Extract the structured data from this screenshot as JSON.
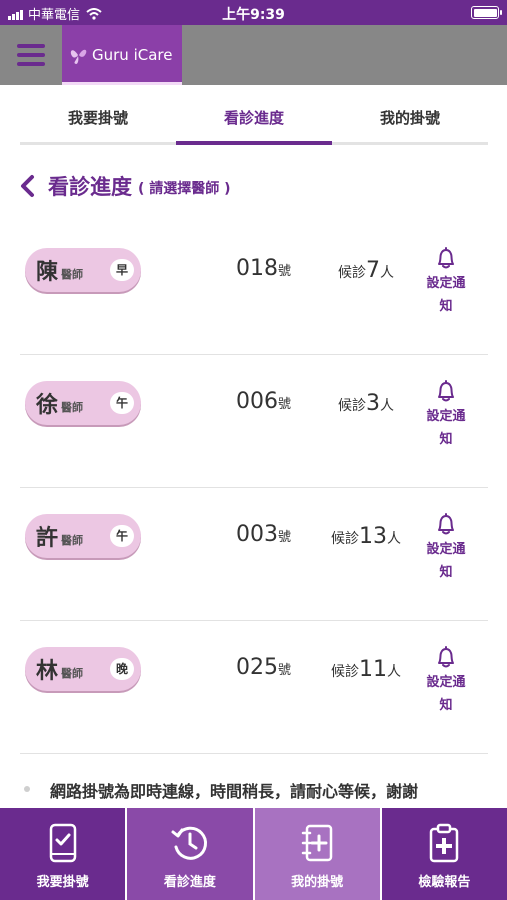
{
  "status_bar": {
    "carrier": "中華電信",
    "time": "上午9:39"
  },
  "header": {
    "brand": "Guru iCare"
  },
  "tabs": [
    {
      "label": "我要掛號"
    },
    {
      "label": "看診進度"
    },
    {
      "label": "我的掛號"
    }
  ],
  "section": {
    "title": "看診進度",
    "hint": "( 請選擇醫師 )"
  },
  "doctors": [
    {
      "surname": "陳",
      "title": "醫師",
      "shift": "早",
      "number": "018",
      "number_unit": "號",
      "wait_prefix": "候診",
      "wait_count": "7",
      "wait_unit": "人",
      "notify_line1": "設定通",
      "notify_line2": "知"
    },
    {
      "surname": "徐",
      "title": "醫師",
      "shift": "午",
      "number": "006",
      "number_unit": "號",
      "wait_prefix": "候診",
      "wait_count": "3",
      "wait_unit": "人",
      "notify_line1": "設定通",
      "notify_line2": "知"
    },
    {
      "surname": "許",
      "title": "醫師",
      "shift": "午",
      "number": "003",
      "number_unit": "號",
      "wait_prefix": "候診",
      "wait_count": "13",
      "wait_unit": "人",
      "notify_line1": "設定通",
      "notify_line2": "知"
    },
    {
      "surname": "林",
      "title": "醫師",
      "shift": "晚",
      "number": "025",
      "number_unit": "號",
      "wait_prefix": "候診",
      "wait_count": "11",
      "wait_unit": "人",
      "notify_line1": "設定通",
      "notify_line2": "知"
    }
  ],
  "notice": {
    "text": "網路掛號為即時連線，時間稍長，請耐心等候，謝謝"
  },
  "bottom_nav": [
    {
      "label": "我要掛號",
      "icon": "phone-check-icon",
      "color": "#6a2b8e"
    },
    {
      "label": "看診進度",
      "icon": "history-clock-icon",
      "color": "#8a4aa8"
    },
    {
      "label": "我的掛號",
      "icon": "notebook-plus-icon",
      "color": "#a872c1"
    },
    {
      "label": "檢驗報告",
      "icon": "clipboard-plus-icon",
      "color": "#6a2b8e"
    }
  ],
  "colors": {
    "primary": "#6a2b8e",
    "pill": "#ecc7e3",
    "header_gray": "#878787"
  }
}
